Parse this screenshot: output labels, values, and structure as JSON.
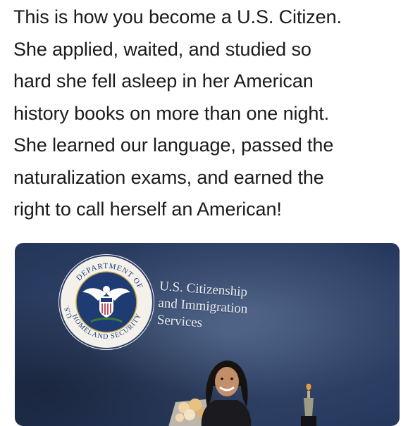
{
  "caption": {
    "lines": [
      "This is how you become a U.S. Citizen.",
      "She applied, waited, and studied so",
      "hard she fell asleep in her American",
      "history books on more than one night.",
      "She learned our language, passed the",
      "naturalization exams, and earned the",
      "right to call herself an American!"
    ]
  },
  "photo": {
    "seal": {
      "top_arc": "DEPARTMENT OF",
      "left_text": "U.S.",
      "bottom_arc": "HOMELAND SECURITY",
      "icon": "eagle-seal-icon"
    },
    "agency_sign": {
      "line1": "U.S. Citizenship",
      "line2": "and Immigration",
      "line3": "Services"
    },
    "colors": {
      "wall": "#2f4266",
      "sign_text": "#e9ecf2",
      "caption_text": "#1b1b1b"
    }
  }
}
